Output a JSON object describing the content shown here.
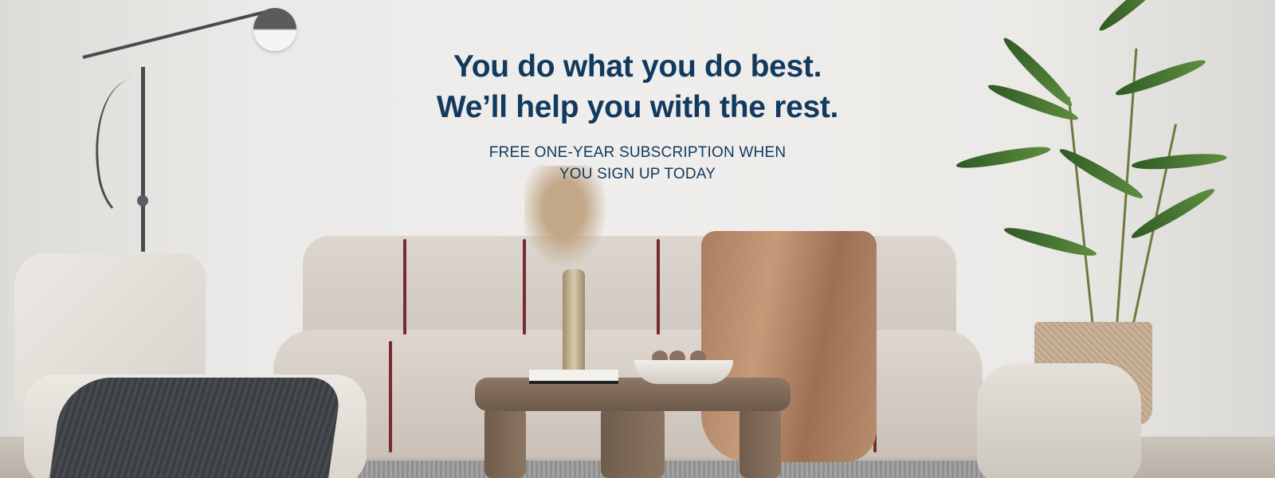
{
  "banner": {
    "headline_line1": "You do what you do best.",
    "headline_line2": "We’ll help you with the rest.",
    "subline_line1": "FREE ONE-YEAR SUBSCRIPTION WHEN",
    "subline_line2": "YOU SIGN UP TODAY"
  },
  "colors": {
    "headline": "#12395e",
    "wall": "#efeeec",
    "accent_seam": "#7a2a2e"
  }
}
